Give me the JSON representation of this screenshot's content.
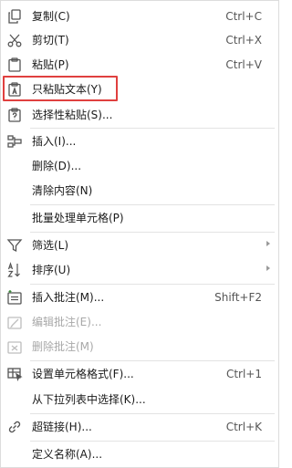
{
  "menu": {
    "copy": {
      "label": "复制(C)",
      "shortcut": "Ctrl+C",
      "icon": "copy-icon"
    },
    "cut": {
      "label": "剪切(T)",
      "shortcut": "Ctrl+X",
      "icon": "scissors-icon"
    },
    "paste": {
      "label": "粘贴(P)",
      "shortcut": "Ctrl+V",
      "icon": "paste-icon"
    },
    "paste_text_only": {
      "label": "只粘贴文本(Y)",
      "icon": "paste-text-icon"
    },
    "paste_special": {
      "label": "选择性粘贴(S)...",
      "icon": "paste-special-icon"
    },
    "insert": {
      "label": "插入(I)...",
      "icon": "insert-cells-icon"
    },
    "delete": {
      "label": "删除(D)..."
    },
    "clear_contents": {
      "label": "清除内容(N)"
    },
    "batch_process": {
      "label": "批量处理单元格(P)"
    },
    "filter": {
      "label": "筛选(L)",
      "icon": "filter-icon"
    },
    "sort": {
      "label": "排序(U)",
      "icon": "sort-icon"
    },
    "insert_comment": {
      "label": "插入批注(M)...",
      "shortcut": "Shift+F2",
      "icon": "insert-comment-icon"
    },
    "edit_comment": {
      "label": "编辑批注(E)...",
      "icon": "edit-comment-icon"
    },
    "delete_comment": {
      "label": "删除批注(M)",
      "icon": "delete-comment-icon"
    },
    "format_cells": {
      "label": "设置单元格格式(F)...",
      "shortcut": "Ctrl+1",
      "icon": "format-cells-icon"
    },
    "pick_from_list": {
      "label": "从下拉列表中选择(K)..."
    },
    "hyperlink": {
      "label": "超链接(H)...",
      "shortcut": "Ctrl+K",
      "icon": "link-icon"
    },
    "define_name": {
      "label": "定义名称(A)..."
    }
  },
  "colors": {
    "highlight_border": "#e0403f",
    "icon_stroke": "#555555",
    "disabled_text": "#a8a8a8"
  }
}
